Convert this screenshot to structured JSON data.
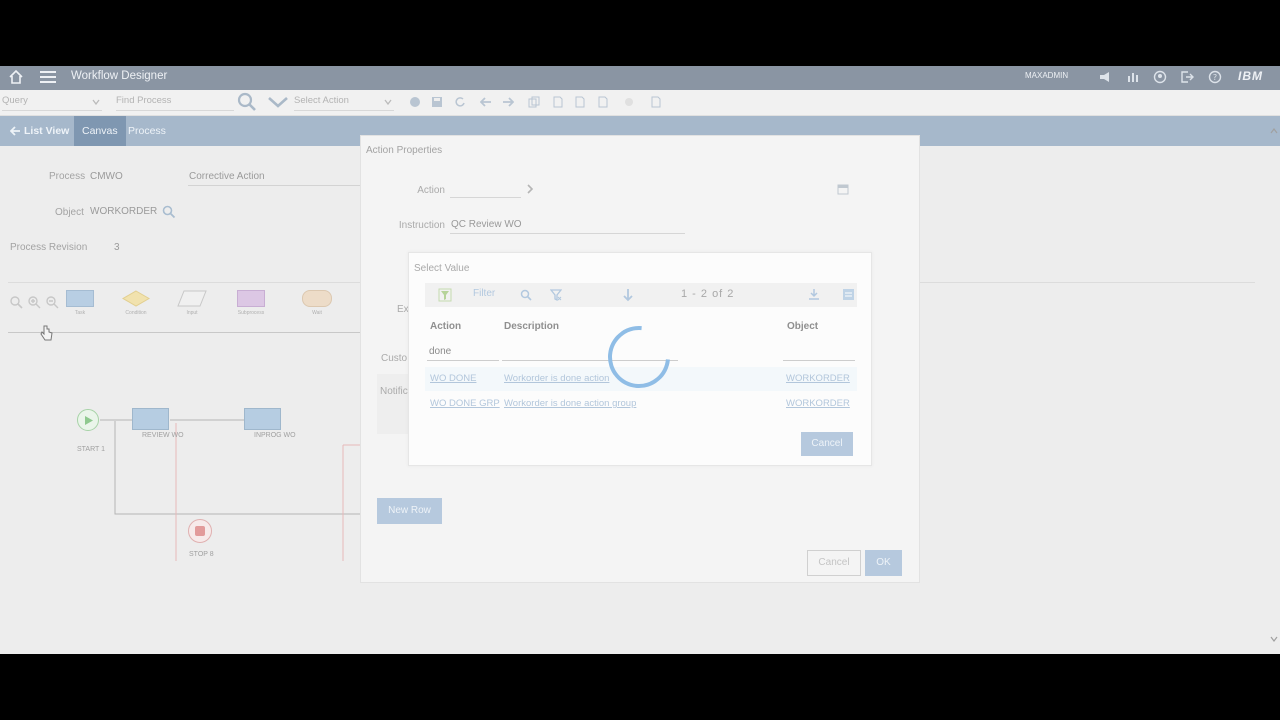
{
  "app": {
    "title": "Workflow Designer",
    "user": "MAXADMIN",
    "brand": "IBM"
  },
  "toolbar": {
    "query_placeholder": "Query",
    "find_process_placeholder": "Find Process",
    "select_action_placeholder": "Select Action"
  },
  "tabs": [
    {
      "label": "List View"
    },
    {
      "label": "Canvas"
    },
    {
      "label": "Process"
    }
  ],
  "process": {
    "process_label": "Process",
    "process_value": "CMWO",
    "description": "Corrective Action",
    "object_label": "Object",
    "object_value": "WORKORDER",
    "revision_label": "Process Revision",
    "revision_value": "3"
  },
  "palette": [
    {
      "label": "Task"
    },
    {
      "label": "Condition"
    },
    {
      "label": "Input"
    },
    {
      "label": "Subprocess"
    },
    {
      "label": "Wait"
    }
  ],
  "canvas_nodes": {
    "start": "START 1",
    "review": "REVIEW WO",
    "inprog": "INPROG WO",
    "stop": "STOP 8"
  },
  "action_properties": {
    "title": "Action Properties",
    "action_label": "Action",
    "instruction_label": "Instruction",
    "instruction_value": "QC Review WO",
    "expression_label": "Ex",
    "customer_label": "Custo",
    "notification_label": "Notific",
    "new_row_button": "New Row",
    "cancel_button": "Cancel",
    "ok_button": "OK"
  },
  "select_value": {
    "title": "Select Value",
    "filter_label": "Filter",
    "pager": "1 - 2 of 2",
    "columns": {
      "action": "Action",
      "description": "Description",
      "object": "Object"
    },
    "filter_action_value": "done",
    "rows": [
      {
        "action": "WO DONE",
        "description": "Workorder is done action",
        "object": "WORKORDER"
      },
      {
        "action": "WO DONE GRP",
        "description": "Workorder is done action group",
        "object": "WORKORDER"
      }
    ],
    "cancel_button": "Cancel"
  },
  "colors": {
    "topbar": "#8a95a3",
    "tabbar": "#a6b8cb",
    "primary_button": "#b6c9de",
    "spinner": "#8fbde6"
  }
}
